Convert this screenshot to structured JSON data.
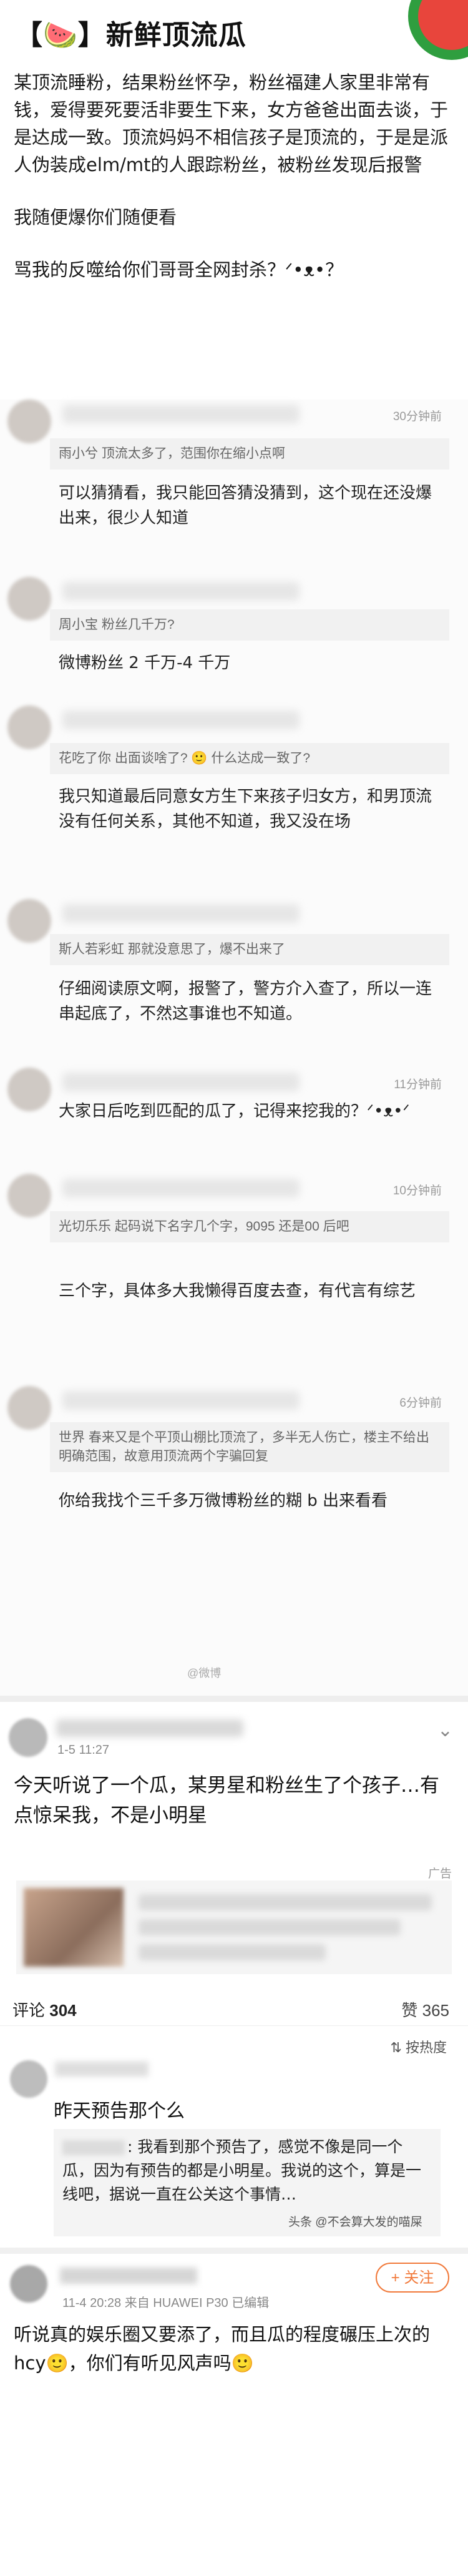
{
  "header": {
    "title": "【🍉】新鲜顶流瓜",
    "watermelon_color": "#2f9e3f"
  },
  "story": {
    "p1": "某顶流睡粉，结果粉丝怀孕，粉丝福建人家里非常有钱，爱得要死要活非要生下来，女方爸爸出面去谈，于是达成一致。顶流妈妈不相信孩子是顶流的，于是是派人伪装成elm/mt的人跟踪粉丝，被粉丝发现后报警",
    "p2": "我随便爆你们随便看",
    "p3": "骂我的反噬给你们哥哥全网封杀？ᐟ•ᴥ•？"
  },
  "thread": [
    {
      "time": "30分钟前",
      "quote": "雨小兮 顶流太多了，范围你在缩小点啊",
      "reply": "可以猜猜看，我只能回答猜没猜到，这个现在还没爆出来，很少人知道"
    },
    {
      "time": "",
      "quote": "周小宝 粉丝几千万?",
      "reply": "微博粉丝 2 千万-4 千万"
    },
    {
      "time": "",
      "quote": "花吃了你 出面谈啥了? 🙂 什么达成一致了?",
      "reply": "我只知道最后同意女方生下来孩子归女方，和男顶流没有任何关系，其他不知道，我又没在场"
    },
    {
      "time": "",
      "quote": "斯人若彩虹 那就没意思了，爆不出来了",
      "reply": "仔细阅读原文啊，报警了，警方介入查了，所以一连串起底了，不然这事谁也不知道。"
    },
    {
      "time": "11分钟前",
      "quote": "",
      "reply": "大家日后吃到匹配的瓜了，记得来挖我的？ᐟ•ᴥ•ᐟ"
    },
    {
      "time": "10分钟前",
      "quote": "光切乐乐 起码说下名字几个字，9095 还是00 后吧",
      "reply": "三个字，具体多大我懒得百度去查，有代言有综艺"
    },
    {
      "time": "6分钟前",
      "quote": "世界 春来又是个平顶山棚比顶流了，多半无人伤亡，楼主不给出明确范围，故意用顶流两个字骗回复",
      "reply": "你给我找个三千多万微博粉丝的糊 b 出来看看"
    }
  ],
  "thread_watermark": "@微博",
  "post": {
    "date": "1-5 11:27",
    "text": "今天听说了一个瓜，某男星和粉丝生了个孩子…有点惊呆我，不是小明星",
    "ad_label": "广告",
    "comments_label": "评论",
    "comments_count": "304",
    "likes_label": "赞",
    "likes_count": "365",
    "sort_icon": "⇅",
    "sort_label": "按热度"
  },
  "comment2": {
    "text": "昨天预告那个么",
    "quote": ": 我看到那个预告了，感觉不像是同一个瓜，因为有预告的都是小明星。我说的这个，算是一线吧，据说一直在公关这个事情…",
    "watermark": "头条 @不会算大发的喵屎"
  },
  "comment3": {
    "meta": "11-4 20:28  来自 HUAWEI P30  已编辑",
    "follow": "+ 关注",
    "text": "听说真的娱乐圈又要添了，而且瓜的程度碾压上次的hcy🙂，你们有听见风声吗🙂"
  }
}
